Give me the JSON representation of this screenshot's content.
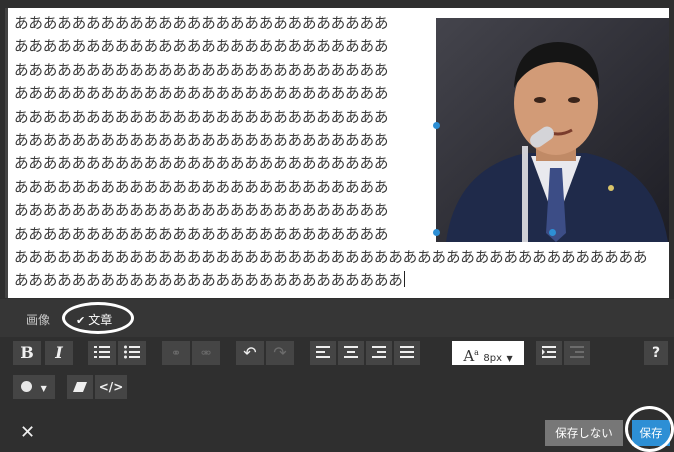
{
  "editor": {
    "text_lines": [
      "ああああああああああああああああああああああああああ",
      "ああああああああああああああああああああああああああ",
      "ああああああああああああああああああああああああああ",
      "ああああああああああああああああああああああああああ",
      "ああああああああああああああああああああああああああ",
      "ああああああああああああああああああああああああああ",
      "ああああああああああああああああああああああああああ",
      "ああああああああああああああああああああああああああ",
      "ああああああああああああああああああああああああああ",
      "ああああああああああああああああああああああああああ",
      "ああああああああああああああああああああああああああああああああああああああああああああ",
      "あああああああああああああああああああああああああああ"
    ]
  },
  "tabs": {
    "image_label": "画像",
    "text_label": "文章"
  },
  "toolbar": {
    "bold": "B",
    "italic": "I",
    "font_size_label": "8px",
    "help": "?"
  },
  "footer": {
    "close": "✕",
    "dont_save": "保存しない",
    "save": "保存"
  },
  "colors": {
    "accent": "#2d8fd5",
    "toolbar_bg": "#2f2f2f",
    "button_bg": "#454545"
  },
  "icons": [
    "bold-icon",
    "italic-icon",
    "ordered-list-icon",
    "unordered-list-icon",
    "link-icon",
    "unlink-icon",
    "undo-icon",
    "redo-icon",
    "align-left-icon",
    "align-center-icon",
    "align-right-icon",
    "align-justify-icon",
    "font-size-icon",
    "indent-icon",
    "outdent-icon",
    "help-icon",
    "color-icon",
    "eraser-icon",
    "code-icon",
    "close-icon",
    "check-icon"
  ]
}
